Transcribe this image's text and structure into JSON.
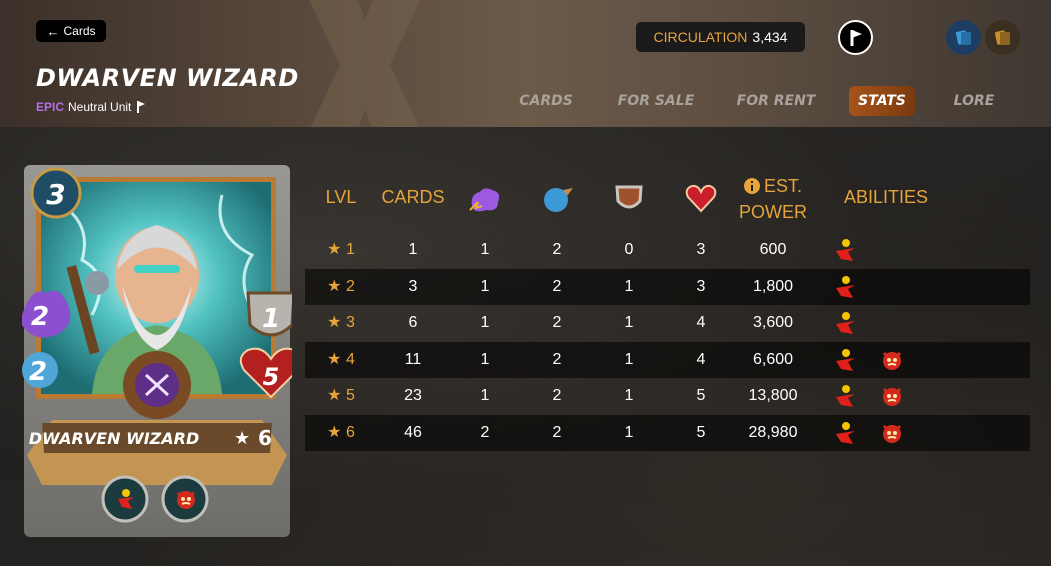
{
  "header": {
    "back_label": "Cards",
    "title": "DWARVEN WIZARD",
    "rarity": "EPIC",
    "unit_type": "Neutral Unit",
    "circulation_label": "CIRCULATION",
    "circulation_value": "3,434",
    "edition_icon": "pointer-flag-icon",
    "collection_icons": [
      "blue-cards-icon",
      "gold-cards-icon"
    ]
  },
  "tabs": [
    {
      "label": "CARDS",
      "active": false
    },
    {
      "label": "FOR SALE",
      "active": false
    },
    {
      "label": "FOR RENT",
      "active": false
    },
    {
      "label": "STATS",
      "active": true
    },
    {
      "label": "LORE",
      "active": false
    }
  ],
  "card": {
    "name": "DWARVEN WIZARD",
    "level": "6",
    "mana": "3",
    "magic": "2",
    "speed": "2",
    "armor": "1",
    "health": "5",
    "abilities": [
      "blast-icon",
      "demoralize-icon"
    ],
    "colors": {
      "frame": "#8c8a86",
      "art_bg": "#3fb4b8",
      "accent": "#c8812e"
    }
  },
  "table": {
    "headers": {
      "lvl": "LVL",
      "cards": "CARDS",
      "magic": "magic-icon",
      "speed": "speed-icon",
      "armor": "armor-icon",
      "health": "health-icon",
      "power_line1": "EST.",
      "power_line2": "POWER",
      "power_info": "info-icon",
      "abilities": "ABILITIES"
    },
    "rows": [
      {
        "lvl": "★ 1",
        "cards": "1",
        "magic": "1",
        "speed": "2",
        "armor": "0",
        "health": "3",
        "power": "600",
        "abilities": [
          "blast-icon"
        ]
      },
      {
        "lvl": "★ 2",
        "cards": "3",
        "magic": "1",
        "speed": "2",
        "armor": "1",
        "health": "3",
        "power": "1,800",
        "abilities": [
          "blast-icon"
        ]
      },
      {
        "lvl": "★ 3",
        "cards": "6",
        "magic": "1",
        "speed": "2",
        "armor": "1",
        "health": "4",
        "power": "3,600",
        "abilities": [
          "blast-icon"
        ]
      },
      {
        "lvl": "★ 4",
        "cards": "11",
        "magic": "1",
        "speed": "2",
        "armor": "1",
        "health": "4",
        "power": "6,600",
        "abilities": [
          "blast-icon",
          "demoralize-icon"
        ]
      },
      {
        "lvl": "★ 5",
        "cards": "23",
        "magic": "1",
        "speed": "2",
        "armor": "1",
        "health": "5",
        "power": "13,800",
        "abilities": [
          "blast-icon",
          "demoralize-icon"
        ]
      },
      {
        "lvl": "★ 6",
        "cards": "46",
        "magic": "2",
        "speed": "2",
        "armor": "1",
        "health": "5",
        "power": "28,980",
        "abilities": [
          "blast-icon",
          "demoralize-icon"
        ]
      }
    ]
  }
}
